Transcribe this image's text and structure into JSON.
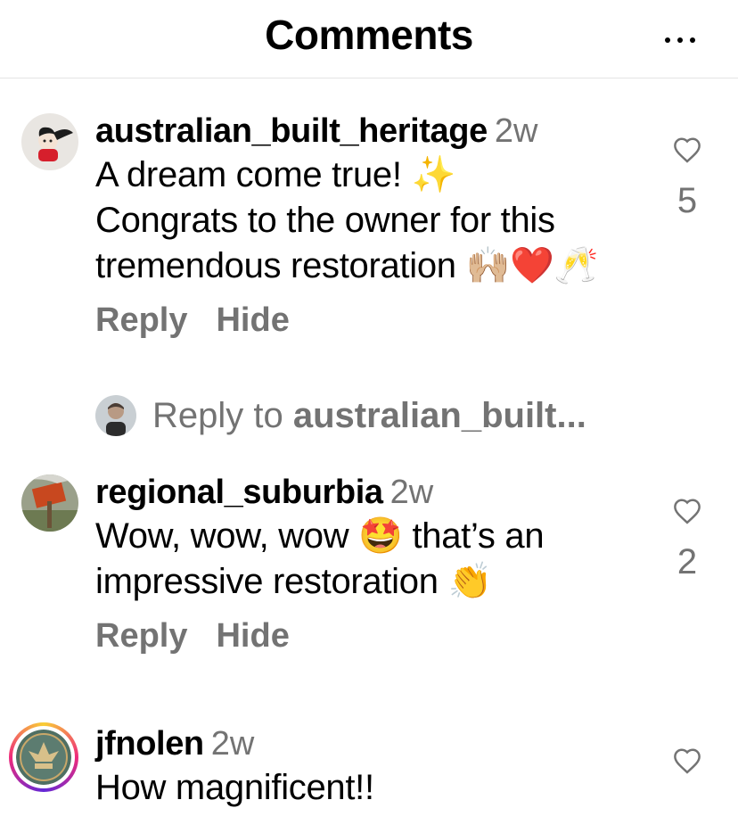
{
  "header": {
    "title": "Comments",
    "more_icon": "more-horizontal-icon"
  },
  "comments": [
    {
      "username": "australian_built_heritage",
      "time": "2w",
      "text_lines": [
        "A dream come true! ✨",
        "Congrats to the owner for this",
        "tremendous restoration 🙌🏼❤️🥂"
      ],
      "reply_label": "Reply",
      "hide_label": "Hide",
      "likes": "5"
    },
    {
      "username": "regional_suburbia",
      "time": "2w",
      "text_lines": [
        "Wow, wow, wow 🤩 that’s an",
        "impressive restoration 👏"
      ],
      "reply_label": "Reply",
      "hide_label": "Hide",
      "likes": "2"
    },
    {
      "username": "jfnolen",
      "time": "2w",
      "text_lines": [
        "How magnificent!!"
      ]
    }
  ],
  "reply_to": {
    "prefix": "Reply to ",
    "username": "australian_built..."
  },
  "colors": {
    "secondary_text": "#737373",
    "divider": "#e4e4e4",
    "story_ring_start": "#f9ce34",
    "story_ring_end": "#ee2a7b"
  }
}
